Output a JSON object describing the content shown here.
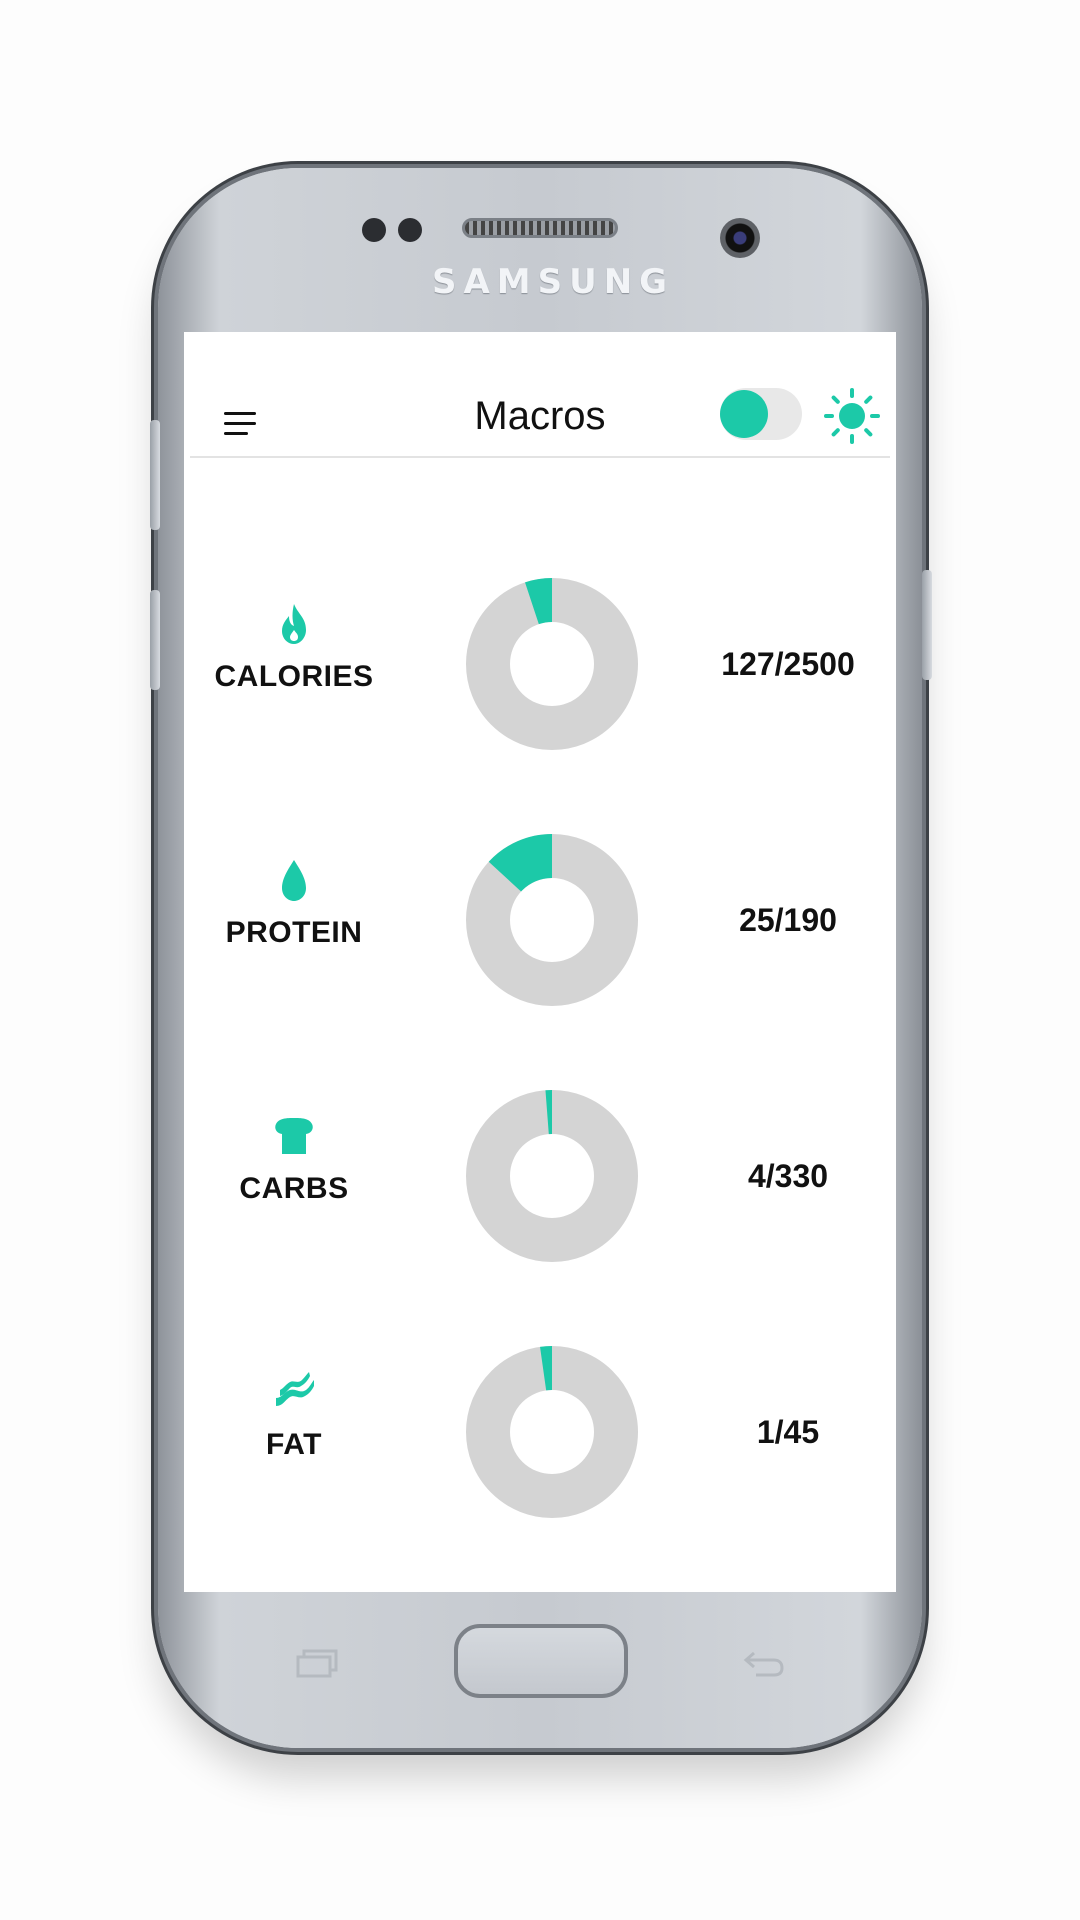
{
  "device": {
    "brand": "SAMSUNG"
  },
  "app": {
    "title": "Macros",
    "menu_icon": "hamburger-menu-icon",
    "theme_toggle": {
      "state": "on",
      "icon": "sun-icon"
    }
  },
  "colors": {
    "accent": "#1cc9a8",
    "track": "#d4d4d4",
    "text": "#111111"
  },
  "macros": [
    {
      "label": "CALORIES",
      "icon": "flame-icon",
      "value": "127/2500",
      "current": 127,
      "goal": 2500
    },
    {
      "label": "PROTEIN",
      "icon": "drop-icon",
      "value": "25/190",
      "current": 25,
      "goal": 190
    },
    {
      "label": "CARBS",
      "icon": "bread-icon",
      "value": "4/330",
      "current": 4,
      "goal": 330
    },
    {
      "label": "FAT",
      "icon": "bacon-icon",
      "value": "1/45",
      "current": 1,
      "goal": 45
    }
  ]
}
